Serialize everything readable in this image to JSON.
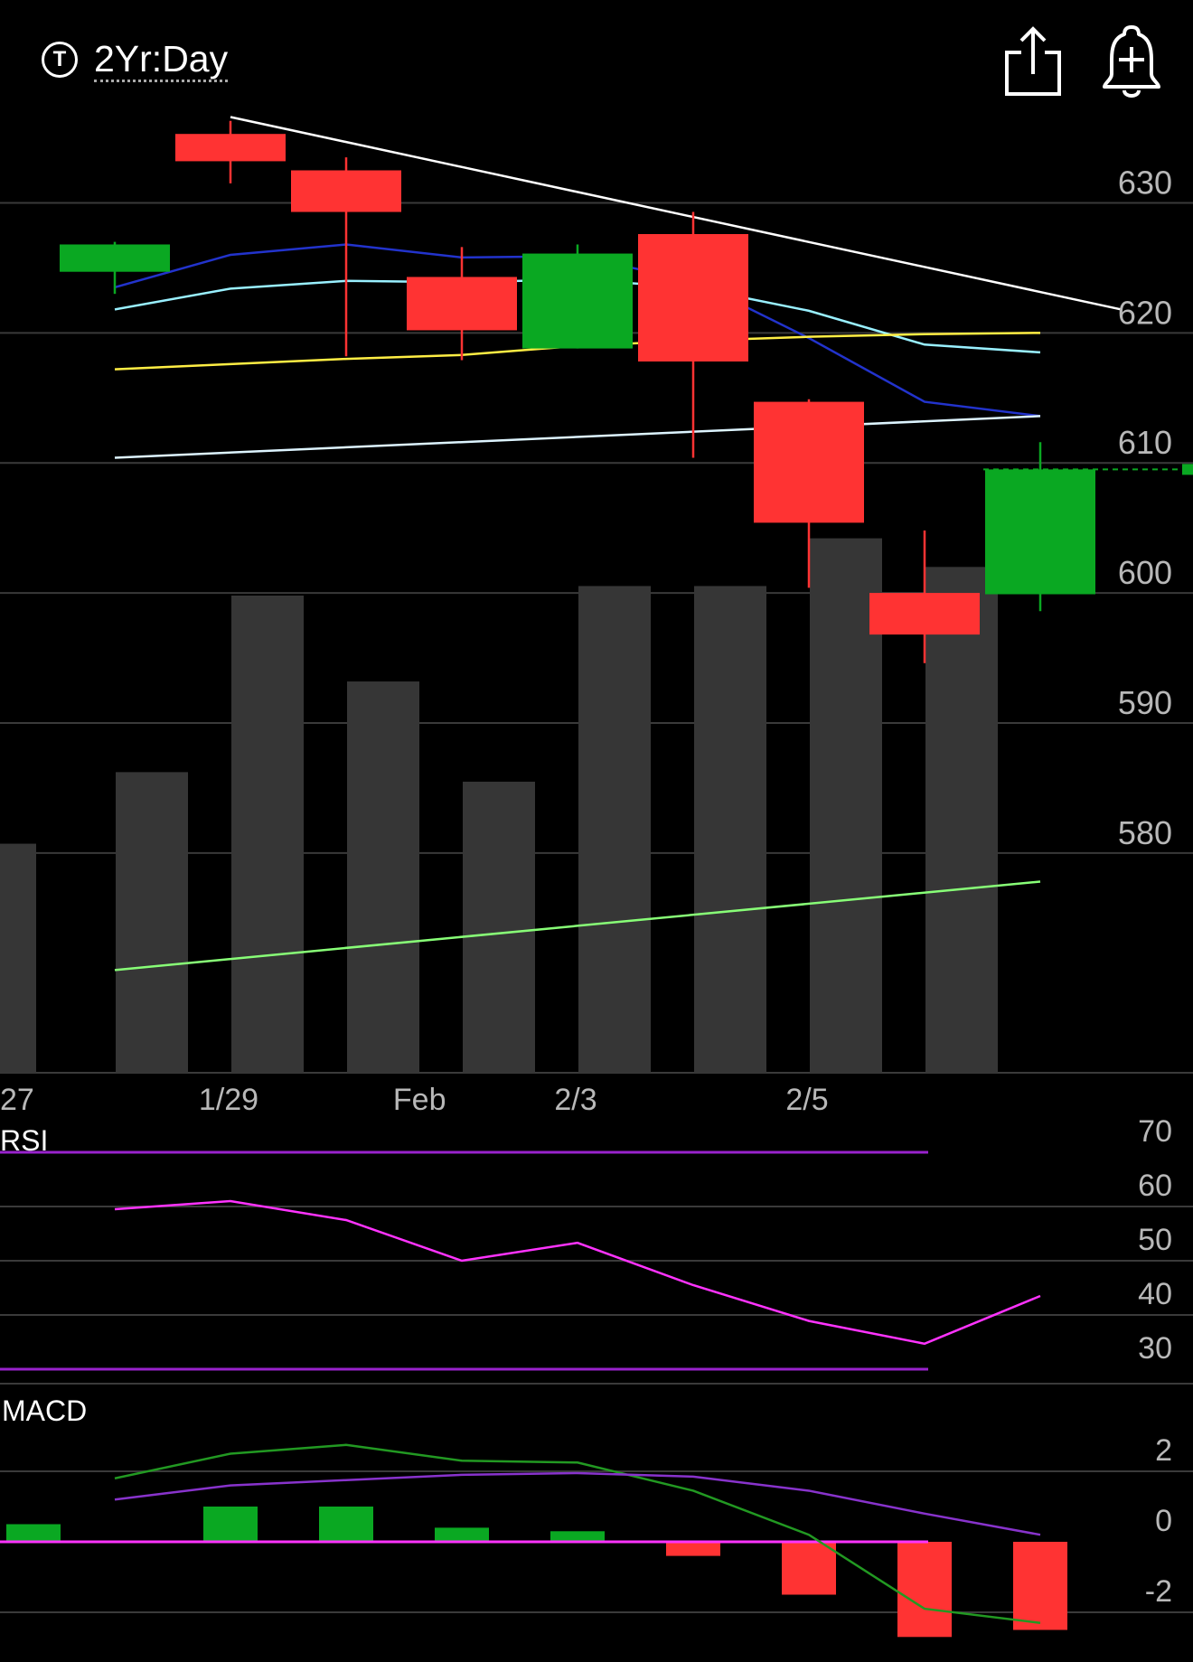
{
  "header": {
    "timeframe_icon": "T",
    "timeframe_label": "2Yr:Day",
    "share_icon": "share-icon",
    "alert_icon": "bell-plus-icon"
  },
  "colors": {
    "background": "#000000",
    "up": "#0aa822",
    "down": "#ff3333",
    "volume": "#363636",
    "grid": "#3a3a3a",
    "trendline": "#ffffff",
    "ma_blue": "#2233cc",
    "ma_cyan": "#99f0ff",
    "ma_yellow": "#ffee44",
    "ma_white": "#ddf4ff",
    "ma_green": "#88ff77",
    "rsi_line": "#ff33ff",
    "rsi_bounds": "#9922cc",
    "macd_line": "#229922",
    "macd_signal": "#8833cc",
    "macd_zero": "#ff33ff"
  },
  "chart_data": [
    {
      "type": "candlestick",
      "price_axis": {
        "ticks": [
          630,
          620,
          610,
          600,
          590,
          580
        ],
        "range": [
          563.1,
          645.6
        ]
      },
      "date_labels": [
        "27",
        "1/29",
        "Feb",
        "2/3",
        "2/5"
      ],
      "candles": [
        {
          "open": 624.7,
          "high": 627.0,
          "low": 623.0,
          "close": 626.8
        },
        {
          "open": 635.3,
          "high": 636.3,
          "low": 631.5,
          "close": 633.2
        },
        {
          "open": 632.5,
          "high": 633.5,
          "low": 618.2,
          "close": 629.3
        },
        {
          "open": 624.3,
          "high": 626.6,
          "low": 617.9,
          "close": 620.2
        },
        {
          "open": 618.8,
          "high": 626.8,
          "low": 618.8,
          "close": 626.1
        },
        {
          "open": 627.6,
          "high": 629.3,
          "low": 610.4,
          "close": 617.8
        },
        {
          "open": 614.7,
          "high": 614.9,
          "low": 600.4,
          "close": 605.4
        },
        {
          "open": 600.0,
          "high": 604.8,
          "low": 594.6,
          "close": 596.8
        },
        {
          "open": 599.9,
          "high": 611.6,
          "low": 598.6,
          "close": 609.5
        }
      ],
      "volume_relative": [
        0.48,
        0.63,
        1.0,
        0.82,
        0.61,
        1.02,
        1.02,
        1.12,
        1.06
      ],
      "last_price": 609.5,
      "overlays": [
        {
          "name": "trendline",
          "x": [
            1,
            8.7
          ],
          "y": [
            636.6,
            621.8
          ]
        },
        {
          "name": "ma_blue",
          "x": [
            0,
            1,
            2,
            3,
            4,
            5,
            6,
            7,
            8
          ],
          "y": [
            623.5,
            626.0,
            626.8,
            625.8,
            625.9,
            624.0,
            619.6,
            614.7,
            613.6
          ]
        },
        {
          "name": "ma_cyan",
          "x": [
            0,
            1,
            2,
            3,
            4,
            5,
            6,
            7,
            8
          ],
          "y": [
            621.8,
            623.4,
            624.0,
            623.9,
            624.1,
            623.5,
            621.7,
            619.1,
            618.5
          ]
        },
        {
          "name": "ma_yellow",
          "x": [
            0,
            1,
            2,
            3,
            4,
            5,
            6,
            7,
            8
          ],
          "y": [
            617.2,
            617.6,
            618.0,
            618.3,
            619.0,
            619.4,
            619.7,
            619.9,
            620.0
          ]
        },
        {
          "name": "ma_white",
          "x": [
            0,
            8
          ],
          "y": [
            610.4,
            613.6
          ]
        },
        {
          "name": "ma_green",
          "x": [
            0,
            8
          ],
          "y": [
            571.0,
            577.8
          ]
        }
      ]
    },
    {
      "type": "line",
      "title": "RSI",
      "y_ticks": [
        70,
        60,
        50,
        40,
        30
      ],
      "bounds": [
        70,
        30
      ],
      "values": [
        59.5,
        61.0,
        57.5,
        50.0,
        53.3,
        45.5,
        38.9,
        34.7,
        43.5
      ]
    },
    {
      "type": "bar+line",
      "title": "MACD",
      "y_ticks": [
        2,
        0,
        -2
      ],
      "histogram": [
        0.5,
        1.0,
        1.0,
        0.4,
        0.3,
        -0.4,
        -1.5,
        -2.7,
        -2.5
      ],
      "macd": [
        1.8,
        2.5,
        2.75,
        2.3,
        2.25,
        1.45,
        0.2,
        -1.9,
        -2.3
      ],
      "signal": [
        1.2,
        1.6,
        1.75,
        1.9,
        1.95,
        1.85,
        1.45,
        0.8,
        0.2
      ]
    }
  ]
}
